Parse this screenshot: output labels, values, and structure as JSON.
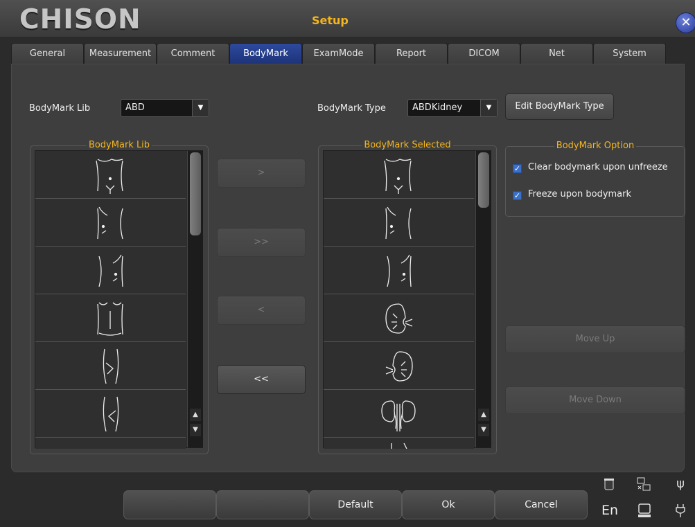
{
  "window": {
    "logo": "CHISON",
    "title": "Setup",
    "close_glyph": "✕"
  },
  "tabs": [
    {
      "label": "General",
      "active": false
    },
    {
      "label": "Measurement",
      "active": false
    },
    {
      "label": "Comment",
      "active": false
    },
    {
      "label": "BodyMark",
      "active": true
    },
    {
      "label": "ExamMode",
      "active": false
    },
    {
      "label": "Report",
      "active": false
    },
    {
      "label": "DICOM",
      "active": false
    },
    {
      "label": "Net",
      "active": false
    },
    {
      "label": "System",
      "active": false
    }
  ],
  "lib_field": {
    "label": "BodyMark Lib",
    "value": "ABD"
  },
  "type_field": {
    "label": "BodyMark Type",
    "value": "ABDKidney"
  },
  "edit_type_button": "Edit BodyMark Type",
  "lib_list": {
    "title": "BodyMark Lib",
    "items": [
      "abdomen-transverse-mark",
      "abdomen-left-mark",
      "abdomen-right-mark",
      "abdomen-longitudinal-mark",
      "flank-left-mark",
      "flank-right-mark"
    ]
  },
  "selected_list": {
    "title": "BodyMark Selected",
    "items": [
      "abdomen-transverse-mark",
      "abdomen-left-mark",
      "abdomen-right-mark",
      "kidney-left-mark",
      "kidney-right-mark",
      "kidneys-bilateral-mark"
    ]
  },
  "transfer": {
    "add": ">",
    "add_all": ">>",
    "remove": "<",
    "remove_all": "<<"
  },
  "options": {
    "title": "BodyMark Option",
    "clear_on_unfreeze": {
      "label": "Clear bodymark upon unfreeze",
      "checked": true
    },
    "freeze_on_bodymark": {
      "label": "Freeze upon bodymark",
      "checked": true
    }
  },
  "move_up": "Move Up",
  "move_down": "Move Down",
  "footer": {
    "default": "Default",
    "ok": "Ok",
    "cancel": "Cancel",
    "language": "En"
  },
  "status_icons": [
    "recycle-bin-icon",
    "network-icon",
    "usb-icon",
    "language-indicator",
    "printer-icon",
    "power-plug-icon"
  ],
  "colors": {
    "accent": "#f5b51f",
    "active_tab": "#1d3278",
    "check": "#3a70c8"
  }
}
